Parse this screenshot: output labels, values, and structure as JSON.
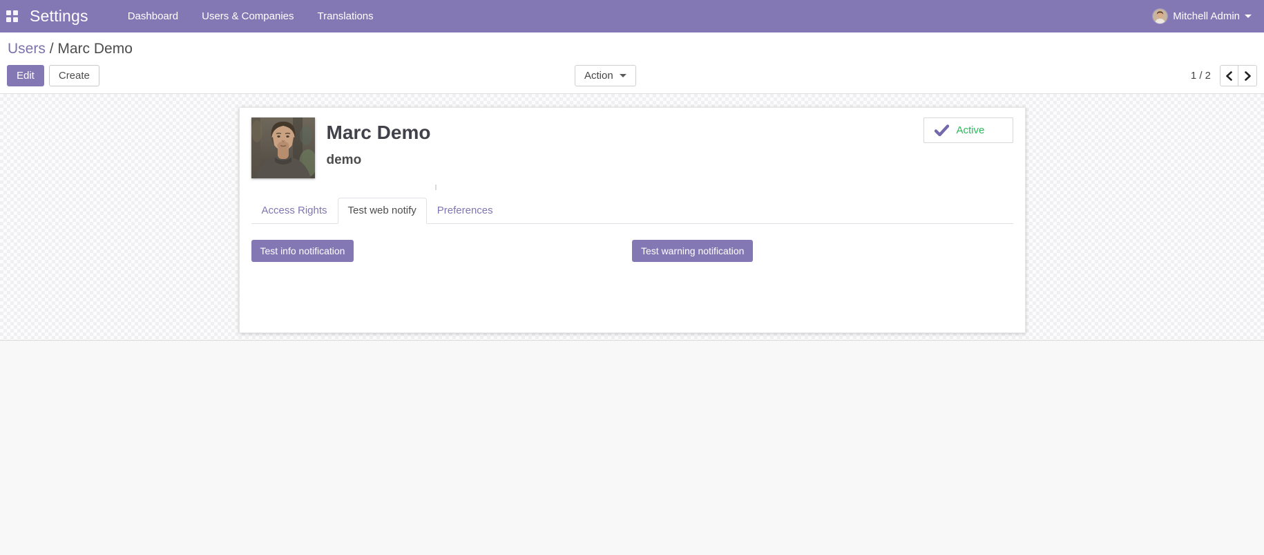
{
  "navbar": {
    "app_title": "Settings",
    "menu_items": [
      {
        "label": "Dashboard"
      },
      {
        "label": "Users & Companies"
      },
      {
        "label": "Translations"
      }
    ],
    "user_name": "Mitchell Admin"
  },
  "control_panel": {
    "breadcrumb": {
      "parent": "Users",
      "separator": "/",
      "current": "Marc Demo"
    },
    "edit_label": "Edit",
    "create_label": "Create",
    "action_label": "Action",
    "pager_text": "1 / 2"
  },
  "record": {
    "title": "Marc Demo",
    "subtitle": "demo",
    "status_badge": {
      "label": "Active",
      "icon": "check-icon"
    }
  },
  "notebook": {
    "tabs": [
      {
        "label": "Access Rights",
        "active": false
      },
      {
        "label": "Test web notify",
        "active": true
      },
      {
        "label": "Preferences",
        "active": false
      }
    ],
    "buttons": [
      {
        "label": "Test info notification"
      },
      {
        "label": "Test warning notification"
      }
    ]
  },
  "colors": {
    "accent_purple": "#8478b4",
    "link_purple": "#8075b2",
    "success_green": "#2eb85c",
    "check_purple": "#7569ae"
  }
}
